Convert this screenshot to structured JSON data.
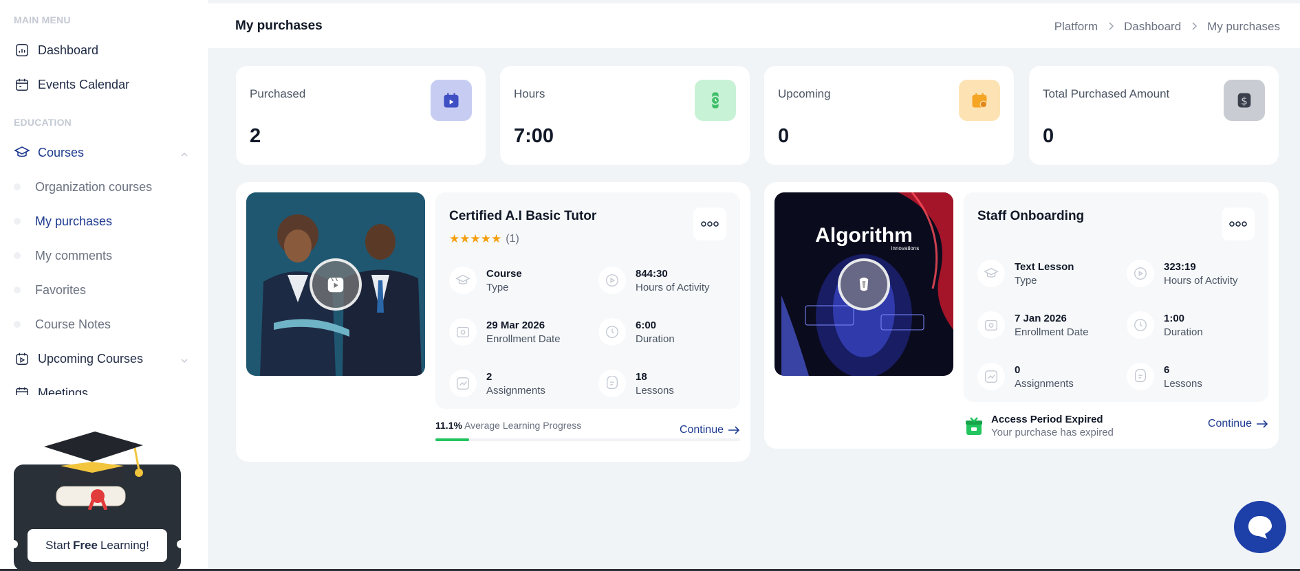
{
  "sidebar": {
    "main_menu_title": "MAIN MENU",
    "education_title": "EDUCATION",
    "items": {
      "dashboard": "Dashboard",
      "events_calendar": "Events Calendar",
      "courses": "Courses",
      "upcoming_courses": "Upcoming Courses",
      "meetings": "Meetings"
    },
    "course_sub": [
      "Organization courses",
      "My purchases",
      "My comments",
      "Favorites",
      "Course Notes"
    ],
    "promo": {
      "pre": "Start",
      "bold": "Free",
      "post": "Learning!"
    }
  },
  "header": {
    "title": "My purchases",
    "breadcrumb": [
      "Platform",
      "Dashboard",
      "My purchases"
    ]
  },
  "stats": [
    {
      "label": "Purchased",
      "value": "2",
      "icon": "calendar-play-icon",
      "color": "#c7cdf2"
    },
    {
      "label": "Hours",
      "value": "7:00",
      "icon": "watch-icon",
      "color": "#c8f2d6"
    },
    {
      "label": "Upcoming",
      "value": "0",
      "icon": "calendar-clock-icon",
      "color": "#fde3b3"
    },
    {
      "label": "Total Purchased Amount",
      "value": "0",
      "icon": "dollar-icon",
      "color": "#c9ccd3"
    }
  ],
  "courses": [
    {
      "title": "Certified A.I Basic Tutor",
      "rating_count": "(1)",
      "stars": 5,
      "meta": [
        {
          "value": "Course",
          "label": "Type",
          "icon": "graduation-icon"
        },
        {
          "value": "844:30",
          "label": "Hours of Activity",
          "icon": "play-circle-icon"
        },
        {
          "value": "29 Mar 2026",
          "label": "Enrollment Date",
          "icon": "camera-icon"
        },
        {
          "value": "6:00",
          "label": "Duration",
          "icon": "clock-icon"
        },
        {
          "value": "2",
          "label": "Assignments",
          "icon": "chart-icon"
        },
        {
          "value": "18",
          "label": "Lessons",
          "icon": "lessons-icon"
        }
      ],
      "progress_value": "11.1%",
      "progress_text": "Average Learning Progress",
      "progress_fraction": 0.111,
      "continue_label": "Continue"
    },
    {
      "title": "Staff Onboarding",
      "meta": [
        {
          "value": "Text Lesson",
          "label": "Type",
          "icon": "graduation-icon"
        },
        {
          "value": "323:19",
          "label": "Hours of Activity",
          "icon": "play-circle-icon"
        },
        {
          "value": "7 Jan 2026",
          "label": "Enrollment Date",
          "icon": "camera-icon"
        },
        {
          "value": "1:00",
          "label": "Duration",
          "icon": "clock-icon"
        },
        {
          "value": "0",
          "label": "Assignments",
          "icon": "chart-icon"
        },
        {
          "value": "6",
          "label": "Lessons",
          "icon": "lessons-icon"
        }
      ],
      "thumb_brand": "Algorithm",
      "thumb_sub": "innovations",
      "expired_title": "Access Period Expired",
      "expired_text": "Your purchase has expired",
      "continue_label": "Continue"
    }
  ]
}
